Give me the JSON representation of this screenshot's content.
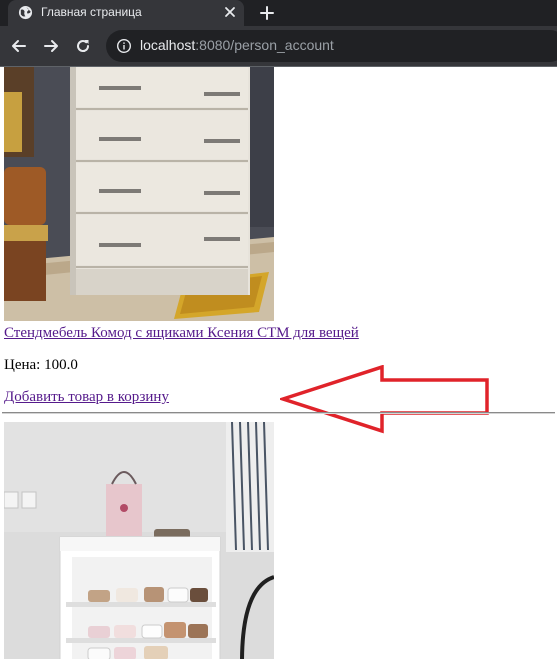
{
  "browser": {
    "tab_title": "Главная страница",
    "url_host": "localhost",
    "url_rest": ":8080/person_account"
  },
  "product": {
    "name": "Стендмебель Комод с ящиками Ксения СТМ для вещей",
    "price_label": "Цена:",
    "price_value": "100.0",
    "cart_link": "Добавить товар в корзину"
  },
  "annotation": {
    "color": "#e0232a"
  }
}
